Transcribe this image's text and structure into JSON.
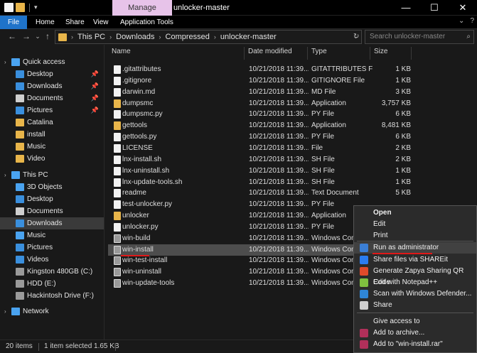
{
  "window": {
    "title": "unlocker-master",
    "manage_tab": "Manage",
    "min": "—",
    "max": "☐",
    "close": "✕"
  },
  "ribbon": {
    "tabs": [
      "File",
      "Home",
      "Share",
      "View",
      "Application Tools"
    ]
  },
  "nav": {
    "back": "←",
    "forward": "→",
    "down": "⌄",
    "up": "↑",
    "breadcrumb": [
      "This PC",
      "Downloads",
      "Compressed",
      "unlocker-master"
    ],
    "refresh": "↻",
    "search_placeholder": "Search unlocker-master"
  },
  "sidebar": {
    "items": [
      {
        "label": "Quick access",
        "icon": "star-icon",
        "color": "#4aa3f0",
        "pinned": false
      },
      {
        "label": "Desktop",
        "icon": "desktop-icon",
        "color": "#3a8fdd",
        "pinned": true
      },
      {
        "label": "Downloads",
        "icon": "download-icon",
        "color": "#3a8fdd",
        "pinned": true
      },
      {
        "label": "Documents",
        "icon": "documents-icon",
        "color": "#cfcfcf",
        "pinned": true
      },
      {
        "label": "Pictures",
        "icon": "pictures-icon",
        "color": "#3a8fdd",
        "pinned": true
      },
      {
        "label": "Catalina",
        "icon": "folder-icon",
        "color": "#e8b54a",
        "pinned": false
      },
      {
        "label": "install",
        "icon": "folder-icon",
        "color": "#e8b54a",
        "pinned": false
      },
      {
        "label": "Music",
        "icon": "folder-icon",
        "color": "#e8b54a",
        "pinned": false
      },
      {
        "label": "Video",
        "icon": "folder-icon",
        "color": "#e8b54a",
        "pinned": false
      },
      {
        "label": "This PC",
        "icon": "computer-icon",
        "color": "#4aa3f0",
        "pinned": false
      },
      {
        "label": "3D Objects",
        "icon": "3d-objects-icon",
        "color": "#4aa3f0",
        "pinned": false
      },
      {
        "label": "Desktop",
        "icon": "desktop-icon",
        "color": "#3a8fdd",
        "pinned": false
      },
      {
        "label": "Documents",
        "icon": "documents-icon",
        "color": "#cfcfcf",
        "pinned": false
      },
      {
        "label": "Downloads",
        "icon": "download-icon",
        "color": "#3a8fdd",
        "pinned": false
      },
      {
        "label": "Music",
        "icon": "music-icon",
        "color": "#4aa3f0",
        "pinned": false
      },
      {
        "label": "Pictures",
        "icon": "pictures-icon",
        "color": "#3a8fdd",
        "pinned": false
      },
      {
        "label": "Videos",
        "icon": "videos-icon",
        "color": "#3a8fdd",
        "pinned": false
      },
      {
        "label": "Kingston 480GB (C:)",
        "icon": "drive-icon",
        "color": "#9a9a9a",
        "pinned": false
      },
      {
        "label": "HDD (E:)",
        "icon": "drive-icon",
        "color": "#9a9a9a",
        "pinned": false
      },
      {
        "label": "Hackintosh Drive (F:)",
        "icon": "drive-icon",
        "color": "#9a9a9a",
        "pinned": false
      },
      {
        "label": "Network",
        "icon": "network-icon",
        "color": "#4aa3f0",
        "pinned": false
      }
    ]
  },
  "columns": {
    "name": "Name",
    "date": "Date modified",
    "type": "Type",
    "size": "Size"
  },
  "files": [
    {
      "name": ".gitattributes",
      "date": "10/21/2018 11:39...",
      "type": "GITATTRIBUTES File",
      "size": "1 KB",
      "icon": "file"
    },
    {
      "name": ".gitignore",
      "date": "10/21/2018 11:39...",
      "type": "GITIGNORE File",
      "size": "1 KB",
      "icon": "file"
    },
    {
      "name": "darwin.md",
      "date": "10/21/2018 11:39...",
      "type": "MD File",
      "size": "3 KB",
      "icon": "file"
    },
    {
      "name": "dumpsmc",
      "date": "10/21/2018 11:39...",
      "type": "Application",
      "size": "3,757 KB",
      "icon": "app"
    },
    {
      "name": "dumpsmc.py",
      "date": "10/21/2018 11:39...",
      "type": "PY File",
      "size": "6 KB",
      "icon": "file"
    },
    {
      "name": "gettools",
      "date": "10/21/2018 11:39...",
      "type": "Application",
      "size": "8,481 KB",
      "icon": "app"
    },
    {
      "name": "gettools.py",
      "date": "10/21/2018 11:39...",
      "type": "PY File",
      "size": "6 KB",
      "icon": "file"
    },
    {
      "name": "LICENSE",
      "date": "10/21/2018 11:39...",
      "type": "File",
      "size": "2 KB",
      "icon": "file"
    },
    {
      "name": "lnx-install.sh",
      "date": "10/21/2018 11:39...",
      "type": "SH File",
      "size": "2 KB",
      "icon": "file"
    },
    {
      "name": "lnx-uninstall.sh",
      "date": "10/21/2018 11:39...",
      "type": "SH File",
      "size": "1 KB",
      "icon": "file"
    },
    {
      "name": "lnx-update-tools.sh",
      "date": "10/21/2018 11:39...",
      "type": "SH File",
      "size": "1 KB",
      "icon": "file"
    },
    {
      "name": "readme",
      "date": "10/21/2018 11:39...",
      "type": "Text Document",
      "size": "5 KB",
      "icon": "file"
    },
    {
      "name": "test-unlocker.py",
      "date": "10/21/2018 11:39...",
      "type": "PY File",
      "size": "",
      "icon": "file"
    },
    {
      "name": "unlocker",
      "date": "10/21/2018 11:39...",
      "type": "Application",
      "size": "",
      "icon": "app"
    },
    {
      "name": "unlocker.py",
      "date": "10/21/2018 11:39...",
      "type": "PY File",
      "size": "",
      "icon": "file"
    },
    {
      "name": "win-build",
      "date": "10/21/2018 11:39...",
      "type": "Windows Comm",
      "size": "",
      "icon": "cmd"
    },
    {
      "name": "win-install",
      "date": "10/21/2018 11:39...",
      "type": "Windows Comm",
      "size": "",
      "icon": "cmd"
    },
    {
      "name": "win-test-install",
      "date": "10/21/2018 11:39...",
      "type": "Windows Comm",
      "size": "",
      "icon": "cmd"
    },
    {
      "name": "win-uninstall",
      "date": "10/21/2018 11:39...",
      "type": "Windows Comm",
      "size": "",
      "icon": "cmd"
    },
    {
      "name": "win-update-tools",
      "date": "10/21/2018 11:39...",
      "type": "Windows Comm",
      "size": "",
      "icon": "cmd"
    }
  ],
  "selected_index": 16,
  "context_menu": {
    "items": [
      {
        "label": "Open",
        "bold": true,
        "icon": ""
      },
      {
        "label": "Edit",
        "bold": false,
        "icon": ""
      },
      {
        "label": "Print",
        "bold": false,
        "icon": ""
      },
      {
        "label": "Run as administrator",
        "bold": false,
        "icon": "shield-icon",
        "highlighted": true
      },
      {
        "label": "Share files via SHAREit",
        "bold": false,
        "icon": "shareit-icon"
      },
      {
        "label": "Generate Zapya Sharing QR Code",
        "bold": false,
        "icon": "zapya-icon"
      },
      {
        "label": "Edit with Notepad++",
        "bold": false,
        "icon": "notepadpp-icon"
      },
      {
        "label": "Scan with Windows Defender...",
        "bold": false,
        "icon": "defender-icon"
      },
      {
        "label": "Share",
        "bold": false,
        "icon": "share-icon"
      },
      {
        "label": "Give access to",
        "bold": false,
        "icon": ""
      },
      {
        "label": "Add to archive...",
        "bold": false,
        "icon": "winrar-icon"
      },
      {
        "label": "Add to \"win-install.rar\"",
        "bold": false,
        "icon": "winrar-icon"
      }
    ]
  },
  "status": {
    "count": "20 items",
    "selected": "1 item selected  1.65 KB"
  },
  "colors": {
    "file_tab": "#1f73c9",
    "manage_tab": "#e7c3e9",
    "folder": "#e8b54a",
    "underline": "#e01818"
  }
}
